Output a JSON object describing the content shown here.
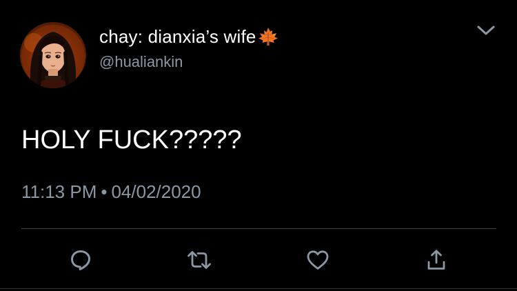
{
  "tweet": {
    "display_name": "chay: dianxia’s wife",
    "name_emoji": "maple-leaf-icon",
    "handle": "@hualiankin",
    "text": "HOLY FUCK?????",
    "time": "11:13 PM",
    "separator": "•",
    "date": "04/02/2020"
  },
  "actions": [
    "reply-icon",
    "retweet-icon",
    "like-icon",
    "share-icon"
  ],
  "colors": {
    "background": "#000000",
    "primary_text": "#ffffff",
    "secondary_text": "#8b98a5",
    "divider": "#38444d",
    "icon": "#8b98a5"
  }
}
